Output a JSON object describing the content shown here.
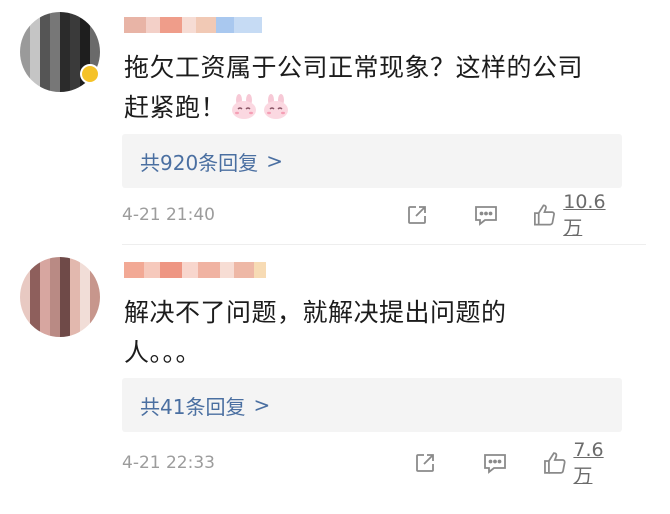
{
  "comments": [
    {
      "text": "拖欠工资属于公司正常现象？这样的公司\n赶紧跑！",
      "reply_label": "共920条回复",
      "reply_arrow": ">",
      "time": "4-21 21:40",
      "likes": "10.6万",
      "emoji": [
        "bunny-emoji",
        "bunny-emoji"
      ]
    },
    {
      "text": "解决不了问题，就解决提出问题的\n人。。。",
      "reply_label": "共41条回复",
      "reply_arrow": ">",
      "time": "4-21 22:33",
      "likes": "7.6万"
    }
  ],
  "colors": {
    "link": "#4a6fa1",
    "reply_bg": "#f4f4f4",
    "meta_text": "#9c9c9c",
    "verified_badge": "#f5c228"
  },
  "icons": [
    "share-icon",
    "comment-icon",
    "like-icon"
  ]
}
